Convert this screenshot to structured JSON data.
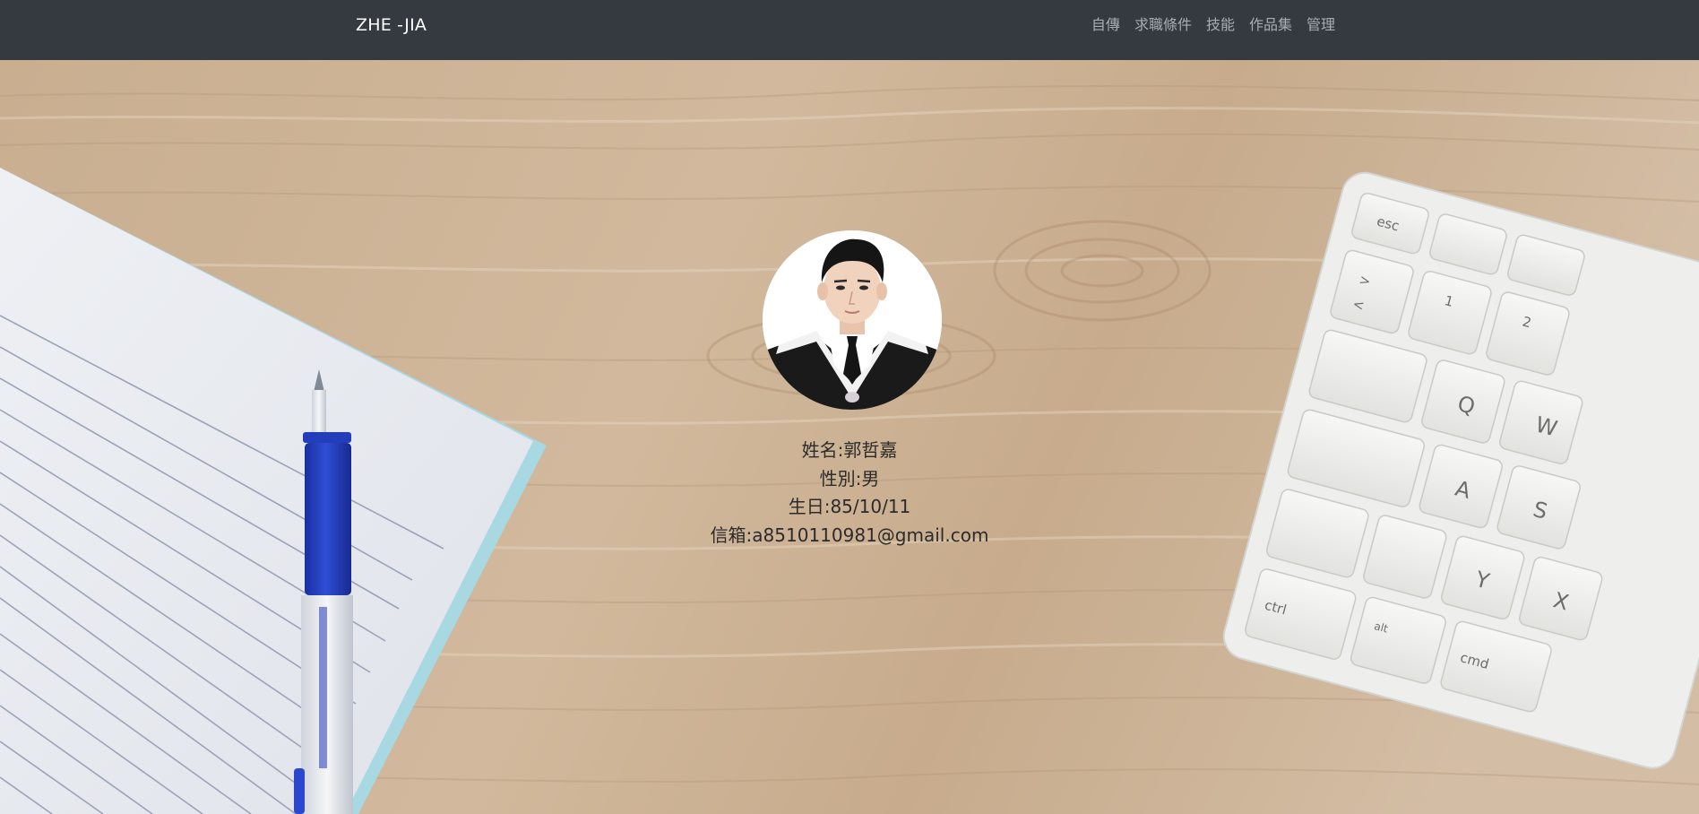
{
  "navbar": {
    "brand": "ZHE -JIA",
    "links": [
      "自傳",
      "求職條件",
      "技能",
      "作品集",
      "管理"
    ]
  },
  "profile": {
    "name_line": "姓名:郭哲嘉",
    "gender_line": "性別:男",
    "birthday_line": "生日:85/10/11",
    "email_line": "信箱:a8510110981@gmail.com"
  },
  "colors": {
    "navbar_bg": "#343a40",
    "brand": "#ffffff",
    "nav_link": "#a8adb2",
    "wood": "#cdb396",
    "text": "#2b2b2b"
  }
}
